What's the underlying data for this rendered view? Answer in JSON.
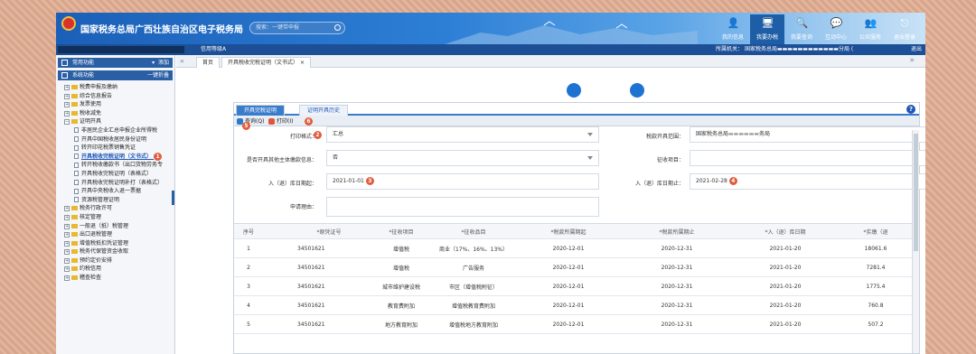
{
  "header": {
    "title": "国家税务总局广西壮族自治区电子税务局",
    "search_placeholder": "搜索：一键带申报",
    "nav": [
      {
        "label": "我的信息",
        "icon": "person-icon"
      },
      {
        "label": "我要办税",
        "icon": "monitor-icon"
      },
      {
        "label": "我要查询",
        "icon": "magnify-icon"
      },
      {
        "label": "互动中心",
        "icon": "chat-icon"
      },
      {
        "label": "公众服务",
        "icon": "people-icon"
      },
      {
        "label": "退出登录",
        "icon": "exit-icon"
      }
    ]
  },
  "subbar": {
    "rating": "信用等级A",
    "org_prefix": "所属机关：",
    "org_name": "国家税务总局",
    "org_suffix": "分局 (",
    "logout": "退出"
  },
  "sidebar": {
    "common_title": "常用功能",
    "common_action": "添加",
    "system_title": "系统功能",
    "system_action": "一键折叠",
    "tree": [
      {
        "label": "税费申报及缴纳",
        "type": "folder",
        "exp": "+"
      },
      {
        "label": "综合信息报告",
        "type": "folder",
        "exp": "+"
      },
      {
        "label": "发票使用",
        "type": "folder",
        "exp": "+"
      },
      {
        "label": "税收减免",
        "type": "folder",
        "exp": "+"
      },
      {
        "label": "证明开具",
        "type": "folder",
        "exp": "−"
      },
      {
        "label": "非居民企业汇总申报企业所得税",
        "type": "child"
      },
      {
        "label": "开具中国税收居民身份证明",
        "type": "child"
      },
      {
        "label": "转开印花税票销售凭证",
        "type": "child"
      },
      {
        "label": "开具税收完税证明（文书式）",
        "type": "child",
        "active": true,
        "badge": "1"
      },
      {
        "label": "转开税收缴款书（出口货物劳务专",
        "type": "child"
      },
      {
        "label": "开具税收完税证明（表格式）",
        "type": "child"
      },
      {
        "label": "开具税收完税证明补打（表格式）",
        "type": "child"
      },
      {
        "label": "开具中央税收入退一票据",
        "type": "child"
      },
      {
        "label": "资源税管理证明",
        "type": "child"
      },
      {
        "label": "税务行政许可",
        "type": "folder",
        "exp": "+"
      },
      {
        "label": "核定管理",
        "type": "folder",
        "exp": "+"
      },
      {
        "label": "一般退（抵）税管理",
        "type": "folder",
        "exp": "+"
      },
      {
        "label": "出口退税管理",
        "type": "folder",
        "exp": "+"
      },
      {
        "label": "增值税抵扣凭证管理",
        "type": "folder",
        "exp": "+"
      },
      {
        "label": "税务代保管资金收取",
        "type": "folder",
        "exp": "+"
      },
      {
        "label": "预约定价安排",
        "type": "folder",
        "exp": "+"
      },
      {
        "label": "约税信用",
        "type": "folder",
        "exp": "+"
      },
      {
        "label": "稽查检查",
        "type": "folder",
        "exp": "+"
      }
    ]
  },
  "tabs": {
    "home": "首页",
    "current": "开具税收完税证明（文书式）",
    "close": "×"
  },
  "panel": {
    "tab_issue": "开具完税证明",
    "tab_history": "证明开具历史",
    "toolbar": {
      "query": "查询(Q)",
      "print": "打印(I)",
      "badge_query": "5",
      "badge_print": "6"
    },
    "form": {
      "print_format_label": "打印格式：",
      "print_format_value": "汇总",
      "badge_format": "2",
      "tax_range_label": "税款开具范围：",
      "tax_range_value": "国家税务总局",
      "tax_range_suffix": "务局",
      "other_info_label": "是否开具其他主体缴款信息：",
      "other_info_value": "否",
      "levy_item_label": "征收项目：",
      "levy_item_value": "",
      "start_label": "入（退）库日期起：",
      "start_value": "2021-01-01",
      "badge_start": "3",
      "end_label": "入（退）库日期止：",
      "end_value": "2021-02-28",
      "badge_end": "4",
      "reason_label": "申请理由：",
      "reason_value": ""
    },
    "columns": [
      "序号",
      "*原凭证号",
      "*征收项目",
      "*征收品目",
      "*税款所属期起",
      "*税款所属期止",
      "*入（退）库日期",
      "*实缴（退"
    ],
    "rows": [
      [
        "1",
        "34501621",
        "增值税",
        "商业（17%、16%、13%）",
        "2020-12-01",
        "2020-12-31",
        "2021-01-20",
        "18061.6"
      ],
      [
        "2",
        "34501621",
        "增值税",
        "广告服务",
        "2020-12-01",
        "2020-12-31",
        "2021-01-20",
        "7281.4"
      ],
      [
        "3",
        "34501621",
        "城市维护建设税",
        "市区（增值税附征）",
        "2020-12-01",
        "2020-12-31",
        "2021-01-20",
        "1775.4"
      ],
      [
        "4",
        "34501621",
        "教育费附加",
        "增值税教育费附加",
        "2020-12-01",
        "2020-12-31",
        "2021-01-20",
        "760.8"
      ],
      [
        "5",
        "34501621",
        "地方教育附加",
        "增值税地方教育附加",
        "2020-12-01",
        "2020-12-31",
        "2021-01-20",
        "507.2"
      ]
    ]
  },
  "colors": {
    "header_blue": "#1b5fb8",
    "accent": "#3a7ccc",
    "badge_red": "#e25b3c"
  }
}
